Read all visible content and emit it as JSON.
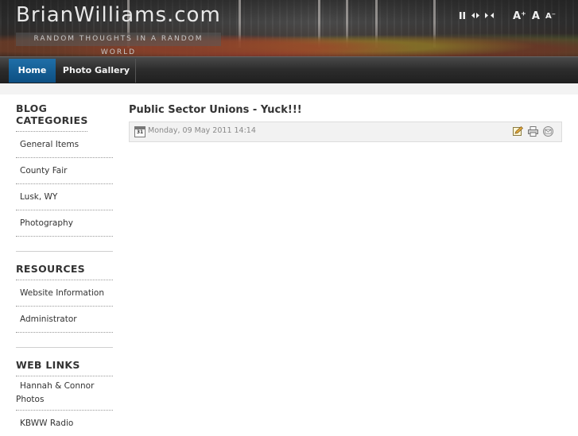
{
  "header": {
    "site_title": "BrianWilliams.com",
    "tagline": "RANDOM THOUGHTS IN A RANDOM WORLD",
    "controls": {
      "pause_icon": "pause-icon",
      "prev_icon": "prev-icon",
      "next_icon": "next-icon",
      "font_increase": "A⁺",
      "font_reset": "A",
      "font_decrease": "A⁻"
    }
  },
  "nav": {
    "items": [
      {
        "label": "Home",
        "active": true
      },
      {
        "label": "Photo Gallery",
        "active": false
      }
    ]
  },
  "sidebar": {
    "sections": [
      {
        "heading": "BLOG CATEGORIES",
        "items": [
          "General Items",
          "County Fair",
          "Lusk, WY",
          "Photography"
        ]
      },
      {
        "heading": "RESOURCES",
        "items": [
          "Website Information",
          "Administrator"
        ]
      },
      {
        "heading": "WEB LINKS",
        "items": [
          "Hannah & Connor Photos",
          "KBWW Radio"
        ]
      }
    ]
  },
  "article": {
    "title": "Public Sector Unions - Yuck!!!",
    "calendar_day": "31",
    "date": "Monday, 09 May 2011 14:14",
    "icons": [
      "edit-icon",
      "print-icon",
      "email-icon"
    ]
  },
  "colors": {
    "active_nav": "#1466a0",
    "text": "#333333",
    "meta_text": "#888888"
  }
}
